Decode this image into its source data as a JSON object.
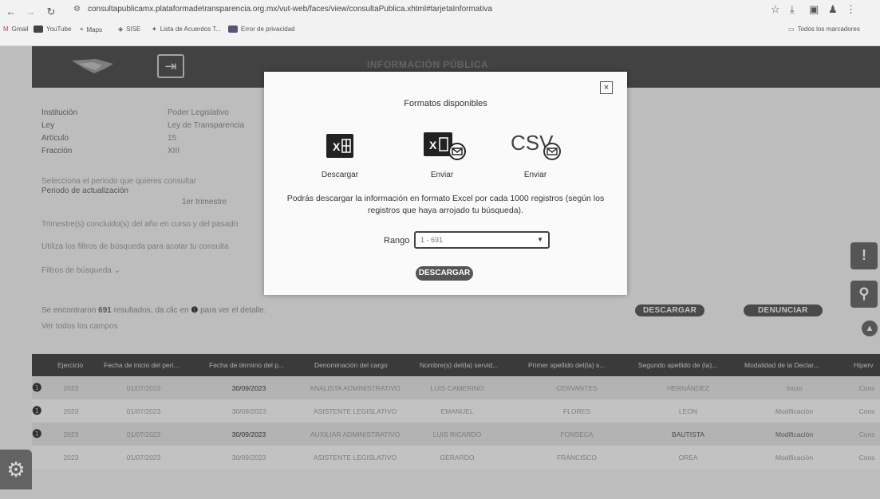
{
  "browser": {
    "url": "consultapublicamx.plataformadetransparencia.org.mx/vut-web/faces/view/consultaPublica.xhtml#tarjetaInformativa",
    "bookmarks": [
      "Gmail",
      "YouTube",
      "Maps",
      "SISE",
      "Lista de Acuerdos T...",
      "Error de privacidad"
    ],
    "all_bookmarks": "Todos los marcadores"
  },
  "page": {
    "title": "INFORMACIÓN PÚBLICA",
    "fields": [
      {
        "label": "Institución",
        "value": "Poder Legislativo"
      },
      {
        "label": "Ley",
        "value": "Ley de Transparencia"
      },
      {
        "label": "Artículo",
        "value": "15"
      },
      {
        "label": "Fracción",
        "value": "XIII"
      }
    ],
    "period_prompt": "Selecciona el periodo que quieres consultar",
    "period_label": "Periodo de actualización",
    "period_option": "1er trimestre",
    "quarter_note": "Trimestre(s) concluido(s) del año en curso y del pasado",
    "filter_note": "Utiliza los filtros de búsqueda para acotar tu consulta",
    "filters_toggle": "Filtros de búsqueda ⌄",
    "results_prefix": "Se encontraron",
    "results_count": "691",
    "results_suffix": "resultados, da clic en",
    "results_end": "para ver el detalle.",
    "see_all_fields": "Ver todos los campos",
    "download_label": "DESCARGAR",
    "report_label": "DENUNCIAR"
  },
  "table": {
    "headers": [
      "Ejercicio",
      "Fecha de inicio del peri...",
      "Fecha de término del p...",
      "Denominación del cargo",
      "Nombre(s) del(la) servid...",
      "Primer apellido del(la) s...",
      "Segundo apellido de (la)...",
      "Modalidad de la Declar...",
      "Hiperv"
    ],
    "rows": [
      [
        "2023",
        "01/07/2023",
        "30/09/2023",
        "ANALISTA ADMINISTRATIVO",
        "LUIS CAMERINO",
        "CERVANTES",
        "HERNÁNDEZ",
        "Inicio",
        "Cons"
      ],
      [
        "2023",
        "01/07/2023",
        "30/09/2023",
        "ASISTENTE LEGISLATIVO",
        "EMANUEL",
        "FLORES",
        "LEÓN",
        "Modificación",
        "Cons"
      ],
      [
        "2023",
        "01/07/2023",
        "30/09/2023",
        "AUXILIAR ADMINISTRATIVO",
        "LUIS RICARDO",
        "FONSECA",
        "BAUTISTA",
        "Modificación",
        "Cons"
      ],
      [
        "2023",
        "01/07/2023",
        "30/09/2023",
        "ASISTENTE LEGISLATIVO",
        "GERARDO",
        "FRANCISCO",
        "OREA",
        "Modificación",
        "Cons"
      ]
    ]
  },
  "modal": {
    "close": "×",
    "title": "Formatos disponibles",
    "formats": [
      {
        "icon": "excel-icon",
        "label": "Descargar"
      },
      {
        "icon": "excel-mail-icon",
        "label": "Enviar"
      },
      {
        "icon": "csv-mail-icon",
        "label": "Enviar"
      }
    ],
    "description": "Podrás descargar la información en formato Excel por cada 1000 registros (según los registros que haya arrojado tu búsqueda).",
    "range_label": "Rango",
    "range_value": "1 - 691",
    "download_button": "DESCARGAR"
  }
}
